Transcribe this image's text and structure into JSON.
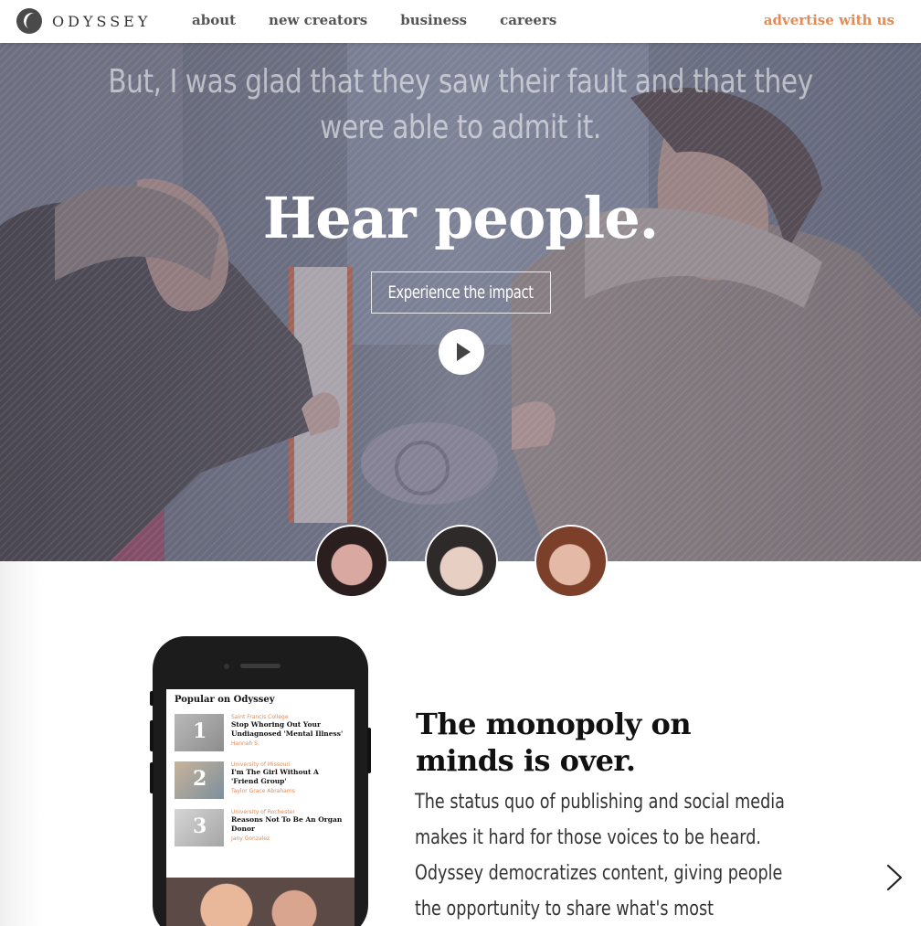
{
  "nav": {
    "logo_text": "ODYSSEY",
    "links": [
      "about",
      "new creators",
      "business",
      "careers"
    ],
    "advertise": "advertise with us"
  },
  "hero": {
    "caption": "But, I was glad that they saw their fault and that they were able to admit it.",
    "title": "Hear people.",
    "cta": "Experience the impact"
  },
  "phone": {
    "popular_title": "Popular on Odyssey",
    "items": [
      {
        "num": "1",
        "school": "Saint Francis College",
        "headline": "Stop Whoring Out Your Undiagnosed 'Mental Illness'",
        "author": "Hannah S."
      },
      {
        "num": "2",
        "school": "University of Missouri",
        "headline": "I'm The Girl Without A 'Friend Group'",
        "author": "Taylor Grace Abrahams"
      },
      {
        "num": "3",
        "school": "University of Rochester",
        "headline": "Reasons Not To Be An Organ Donor",
        "author": "Jany Gonzalez"
      }
    ]
  },
  "feature": {
    "title_line1": "The monopoly on",
    "title_line2": "minds is over.",
    "body": "The status quo of publishing and social media makes it hard for those voices to be heard. Odyssey democratizes content, giving people the opportunity to share what's most important to them and their"
  },
  "colors": {
    "accent": "#e38b57",
    "nav_link": "#555555",
    "heading": "#111111"
  },
  "icons": [
    "odyssey-logo-icon",
    "play-icon",
    "chevron-right-icon"
  ]
}
